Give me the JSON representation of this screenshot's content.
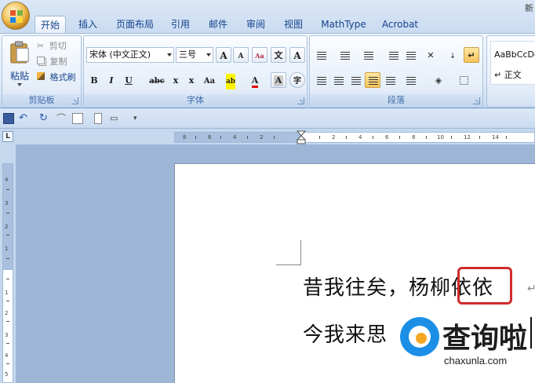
{
  "window": {
    "title": "新"
  },
  "tabs": [
    {
      "label": "开始",
      "active": true
    },
    {
      "label": "插入"
    },
    {
      "label": "页面布局"
    },
    {
      "label": "引用"
    },
    {
      "label": "邮件"
    },
    {
      "label": "审阅"
    },
    {
      "label": "视图"
    },
    {
      "label": "MathType"
    },
    {
      "label": "Acrobat"
    }
  ],
  "clipboard": {
    "paste_label": "粘贴",
    "cut_label": "剪切",
    "copy_label": "复制",
    "format_painter_label": "格式刷",
    "group_label": "剪贴板"
  },
  "font": {
    "font_name": "宋体 (中文正文)",
    "font_size": "三号",
    "grow_label": "A",
    "shrink_label": "A",
    "clear_label": "Aa",
    "phonetic_label": "文",
    "border_label": "A",
    "bold_label": "B",
    "italic_label": "I",
    "underline_label": "U",
    "strike_label": "abc",
    "subscript_label": "x",
    "superscript_label": "x",
    "case_label": "Aa",
    "highlight_label": "ab",
    "color_label": "A",
    "shade_label": "A",
    "enclose_label": "字",
    "group_label": "字体"
  },
  "paragraph": {
    "group_label": "段落"
  },
  "styles": {
    "preview": "AaBbCcDd",
    "normal_label": "正文"
  },
  "ruler": {
    "h_ticks": [
      "8",
      "6",
      "4",
      "2",
      "2",
      "4",
      "6",
      "8",
      "10",
      "12",
      "14"
    ],
    "v_ticks": [
      "4",
      "3",
      "2",
      "1",
      "1",
      "2",
      "3",
      "4",
      "5"
    ],
    "corner_label": "L"
  },
  "document": {
    "line1": "昔我往矣，杨柳依依",
    "line2": "今我来思"
  },
  "watermark": {
    "brand": "查询啦",
    "url": "chaxunla.com"
  },
  "colors": {
    "highlight_box": "#d12b2b",
    "accent": "#15428b",
    "watermark_blue": "#1b8fe6",
    "watermark_orange": "#f5a623"
  }
}
